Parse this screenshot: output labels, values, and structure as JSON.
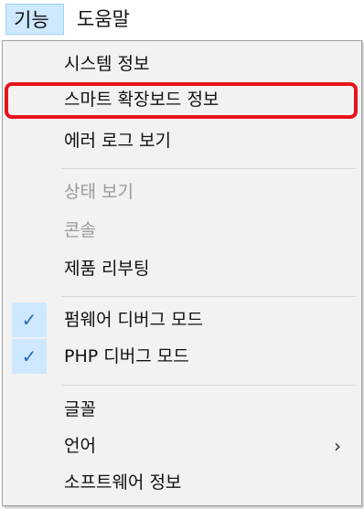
{
  "menubar": {
    "items": [
      {
        "label": "기능",
        "active": true
      },
      {
        "label": "도움말",
        "active": false
      }
    ]
  },
  "dropdown": {
    "groups": [
      {
        "items": [
          {
            "label": "시스템 정보",
            "enabled": true
          },
          {
            "label": "스마트 확장보드 정보",
            "enabled": true,
            "highlighted": true
          },
          {
            "label": "에러 로그 보기",
            "enabled": true
          }
        ]
      },
      {
        "items": [
          {
            "label": "상태 보기",
            "enabled": false
          },
          {
            "label": "콘솔",
            "enabled": false
          },
          {
            "label": "제품 리부팅",
            "enabled": true
          }
        ]
      },
      {
        "items": [
          {
            "label": "펌웨어 디버그 모드",
            "enabled": true,
            "checked": true
          },
          {
            "label": "PHP 디버그 모드",
            "enabled": true,
            "checked": true
          }
        ]
      },
      {
        "items": [
          {
            "label": "글꼴",
            "enabled": true
          },
          {
            "label": "언어",
            "enabled": true,
            "submenu": true
          },
          {
            "label": "소프트웨어 정보",
            "enabled": true
          }
        ]
      }
    ]
  },
  "icons": {
    "check": "checkmark-icon",
    "submenu": "chevron-right-icon"
  },
  "colors": {
    "highlight_border": "#e8141b",
    "active_menu_bg": "#cde8ff",
    "check_bg": "#cde8ff",
    "disabled_text": "#9a9a9a"
  }
}
